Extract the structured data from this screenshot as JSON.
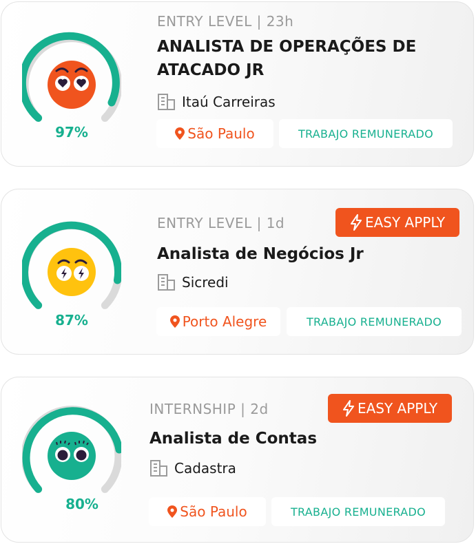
{
  "colors": {
    "accent_green": "#17b08f",
    "accent_orange": "#f0541e",
    "face_red": "#f0541e",
    "face_yellow": "#ffc20e",
    "face_green": "#17b08f"
  },
  "cards": [
    {
      "meta": "ENTRY LEVEL | 23h",
      "title": "ANALISTA DE OPERAÇÕES DE ATACADO JR",
      "company": "Itaú Carreiras",
      "location": "São Paulo",
      "work_type": "TRABAJO REMUNERADO",
      "match_percent": "97%",
      "match_fraction": 0.97,
      "face": "red-heart-eyes-face",
      "easy_apply": null
    },
    {
      "meta": "ENTRY LEVEL | 1d",
      "title": "Analista de Negócios Jr",
      "company": "Sicredi",
      "location": "Porto Alegre",
      "work_type": "TRABAJO REMUNERADO",
      "match_percent": "87%",
      "match_fraction": 0.87,
      "face": "yellow-bolt-eyes-face",
      "easy_apply": "EASY APPLY"
    },
    {
      "meta": "INTERNSHIP | 2d",
      "title": "Analista de Contas",
      "company": "Cadastra",
      "location": "São Paulo",
      "work_type": "TRABAJO REMUNERADO",
      "match_percent": "80%",
      "match_fraction": 0.8,
      "face": "green-round-eyes-face",
      "easy_apply": "EASY APPLY"
    }
  ]
}
